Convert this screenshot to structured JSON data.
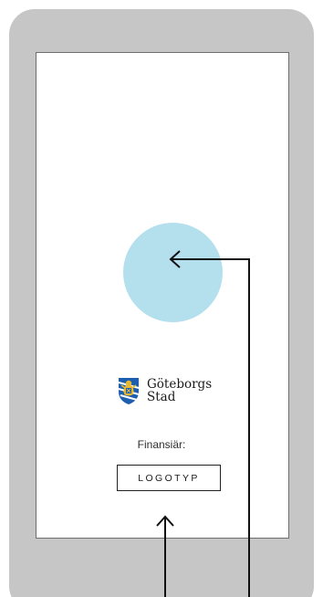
{
  "logo": {
    "line1": "Göteborgs",
    "line2": "Stad",
    "crest_icon": "goteborg-crest-icon"
  },
  "funder_label": "Finansiär:",
  "logo_placeholder": "LOGOTYP",
  "colors": {
    "device_frame": "#c6c6c6",
    "circle": "#b4e0ee",
    "screen": "#ffffff"
  }
}
